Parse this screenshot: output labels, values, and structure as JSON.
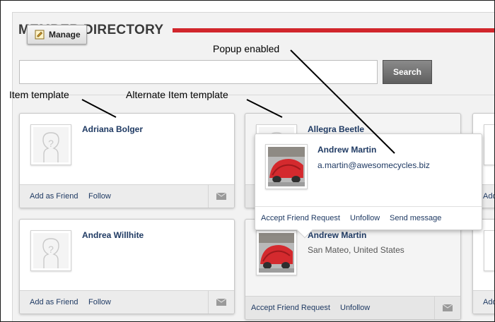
{
  "heading": "MEMBER DIRECTORY",
  "manage_button": {
    "label": "Manage",
    "icon": "pencil-icon"
  },
  "search": {
    "value": "",
    "placeholder": "",
    "button_label": "Search"
  },
  "annotations": {
    "item_template": "Item template",
    "alternate_item_template": "Alternate Item template",
    "popup_enabled": "Popup enabled"
  },
  "members": [
    {
      "name": "Adriana Bolger",
      "links": [
        "Add as Friend",
        "Follow"
      ],
      "photo": "placeholder-avatar"
    },
    {
      "name": "Allegra Beetle",
      "photo": "placeholder-avatar"
    },
    {
      "name": "Andrea Willhite",
      "links": [
        "Add as Friend",
        "Follow"
      ],
      "photo": "placeholder-avatar"
    },
    {
      "name": "Andrew Martin",
      "location": "San Mateo, United States",
      "links": [
        "Accept Friend Request",
        "Unfollow"
      ],
      "photo": "red-covered-car-photo"
    }
  ],
  "right_edge_links": [
    "Add",
    "Add"
  ],
  "popup": {
    "name": "Andrew Martin",
    "email": "a.martin@awesomecycles.biz",
    "links": [
      "Accept Friend Request",
      "Unfollow",
      "Send message"
    ],
    "photo": "red-covered-car-photo"
  },
  "colors": {
    "accent": "#d1262c",
    "link": "#1f3a63",
    "search_button": "#6e6e6e"
  }
}
